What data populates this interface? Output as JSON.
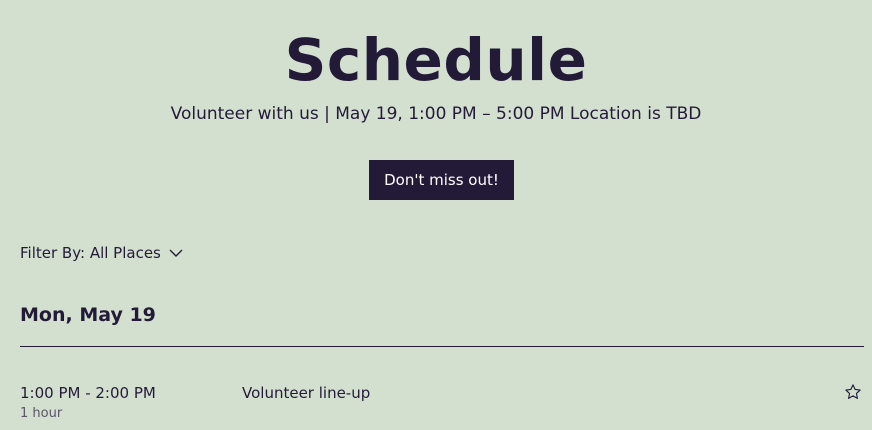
{
  "header": {
    "title": "Schedule",
    "subtitle": "Volunteer with us | May 19, 1:00 PM – 5:00 PM Location is TBD",
    "cta_label": "Don't miss out!"
  },
  "filter": {
    "label": "Filter By: All Places",
    "icon": "chevron-down-icon"
  },
  "schedule": {
    "days": [
      {
        "heading": "Mon, May 19",
        "events": [
          {
            "time": "1:00 PM - 2:00 PM",
            "duration": "1 hour",
            "title": "Volunteer line-up",
            "icon": "star-icon"
          }
        ]
      }
    ]
  },
  "colors": {
    "background": "#d3e0cf",
    "primary": "#231a38",
    "button_text": "#ffffff",
    "muted_text": "#5a5468"
  }
}
